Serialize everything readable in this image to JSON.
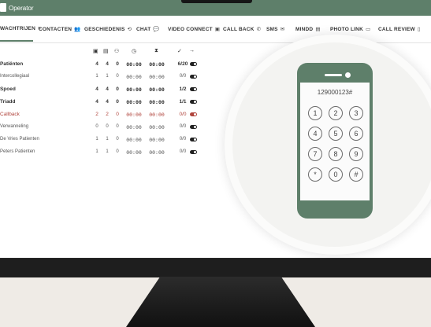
{
  "window": {
    "title": "Operator"
  },
  "nav": [
    {
      "label": "WACHTRIJEN",
      "icon": "≡",
      "icon_name": "menu-icon"
    },
    {
      "label": "CONTACTEN",
      "icon": "👥",
      "icon_name": "contacts-icon"
    },
    {
      "label": "GESCHIEDENIS",
      "icon": "⟲",
      "icon_name": "history-icon"
    },
    {
      "label": "CHAT",
      "icon": "💬",
      "icon_name": "chat-icon"
    },
    {
      "label": "VIDEO CONNECT",
      "icon": "▣",
      "icon_name": "video-icon"
    },
    {
      "label": "CALL BACK",
      "icon": "✆",
      "icon_name": "callback-icon"
    },
    {
      "label": "SMS",
      "icon": "✉",
      "icon_name": "sms-icon"
    },
    {
      "label": "MINDD",
      "icon": "▤",
      "icon_name": "mindd-icon"
    },
    {
      "label": "PHOTO LINK",
      "icon": "▭",
      "icon_name": "photo-icon"
    },
    {
      "label": "CALL REVIEW",
      "icon": "▯",
      "icon_name": "review-icon"
    }
  ],
  "table": {
    "headers": [
      "▣",
      "▤",
      "⚇",
      "◷",
      "⧗",
      "✓",
      "→"
    ],
    "header_icons": [
      "queue-icon",
      "waiting-icon",
      "agents-icon",
      "clock-icon",
      "hourglass-icon",
      "check-icon",
      "login-icon"
    ],
    "rows": [
      {
        "name": "Patiënten",
        "a": "4",
        "b": "4",
        "c": "0",
        "t1": "00:00",
        "t2": "00:00",
        "ratio": "6/20",
        "style": "bold"
      },
      {
        "name": "Intercollegiaal",
        "a": "1",
        "b": "1",
        "c": "0",
        "t1": "00:00",
        "t2": "00:00",
        "ratio": "0/0",
        "style": "light"
      },
      {
        "name": "Spoed",
        "a": "4",
        "b": "4",
        "c": "0",
        "t1": "00:00",
        "t2": "00:00",
        "ratio": "1/2",
        "style": "bold"
      },
      {
        "name": "Triadd",
        "a": "4",
        "b": "4",
        "c": "0",
        "t1": "00:00",
        "t2": "00:00",
        "ratio": "1/1",
        "style": "bold"
      },
      {
        "name": "Callback",
        "a": "2",
        "b": "2",
        "c": "0",
        "t1": "00:00",
        "t2": "00:00",
        "ratio": "0/0",
        "style": "red"
      },
      {
        "name": "Verwanneling",
        "a": "0",
        "b": "0",
        "c": "0",
        "t1": "00:00",
        "t2": "00:00",
        "ratio": "0/0",
        "style": "light"
      },
      {
        "name": "De Vries Patienten",
        "a": "1",
        "b": "1",
        "c": "0",
        "t1": "00:00",
        "t2": "00:00",
        "ratio": "0/0",
        "style": "light"
      },
      {
        "name": "Peters Patienten",
        "a": "1",
        "b": "1",
        "c": "0",
        "t1": "00:00",
        "t2": "00:00",
        "ratio": "0/0",
        "style": "light"
      }
    ]
  },
  "phone": {
    "number": "129000123#",
    "keys": [
      "1",
      "2",
      "3",
      "4",
      "5",
      "6",
      "7",
      "8",
      "9",
      "*",
      "0",
      "#"
    ]
  },
  "colors": {
    "brand": "#5e7f6a",
    "alert": "#b0443c"
  }
}
